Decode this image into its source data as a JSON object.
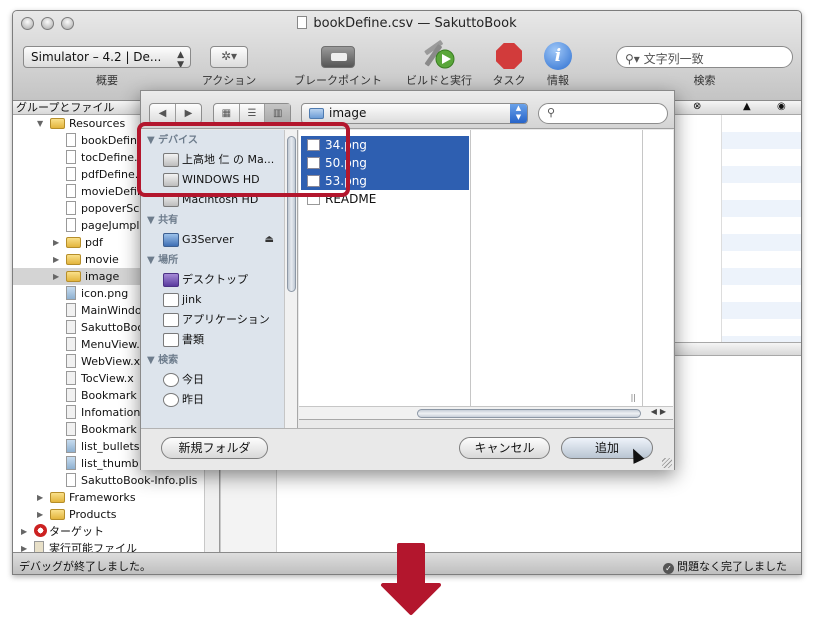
{
  "window": {
    "title": "bookDefine.csv — SakuttoBook",
    "toolbar": {
      "scheme": "Simulator – 4.2 | De...",
      "scheme_label": "概要",
      "action_label": "アクション",
      "breakpoint_label": "ブレークポイント",
      "build_label": "ビルドと実行",
      "task_label": "タスク",
      "info_label": "情報",
      "search_placeholder": "文字列一致",
      "search_label": "検索"
    },
    "sidebar": {
      "header": "グループとファイル",
      "items": [
        {
          "label": "Resources",
          "kind": "folder",
          "indent": 1,
          "open": true
        },
        {
          "label": "bookDefine",
          "kind": "file",
          "indent": 2
        },
        {
          "label": "tocDefine.",
          "kind": "file",
          "indent": 2
        },
        {
          "label": "pdfDefine.",
          "kind": "file",
          "indent": 2
        },
        {
          "label": "movieDefin",
          "kind": "file",
          "indent": 2
        },
        {
          "label": "popoverSc",
          "kind": "file",
          "indent": 2
        },
        {
          "label": "pageJumpl",
          "kind": "file",
          "indent": 2
        },
        {
          "label": "pdf",
          "kind": "folder",
          "indent": 2
        },
        {
          "label": "movie",
          "kind": "folder",
          "indent": 2
        },
        {
          "label": "image",
          "kind": "folder",
          "indent": 2,
          "selected": true
        },
        {
          "label": "icon.png",
          "kind": "img",
          "indent": 2
        },
        {
          "label": "MainWindo",
          "kind": "xib",
          "indent": 2
        },
        {
          "label": "SakuttoBoo",
          "kind": "xib",
          "indent": 2
        },
        {
          "label": "MenuView.",
          "kind": "xib",
          "indent": 2
        },
        {
          "label": "WebView.x",
          "kind": "xib",
          "indent": 2
        },
        {
          "label": "TocView.x",
          "kind": "xib",
          "indent": 2
        },
        {
          "label": "Bookmark",
          "kind": "xib",
          "indent": 2
        },
        {
          "label": "Infomation",
          "kind": "xib",
          "indent": 2
        },
        {
          "label": "Bookmark",
          "kind": "xib",
          "indent": 2
        },
        {
          "label": "list_bullets",
          "kind": "img",
          "indent": 2
        },
        {
          "label": "list_thumb",
          "kind": "img",
          "indent": 2
        },
        {
          "label": "SakuttoBook-Info.plis",
          "kind": "file",
          "indent": 2
        },
        {
          "label": "Frameworks",
          "kind": "folder",
          "indent": 1
        },
        {
          "label": "Products",
          "kind": "folder",
          "indent": 1
        },
        {
          "label": "ターゲット",
          "kind": "target",
          "indent": 0
        },
        {
          "label": "実行可能ファイル",
          "kind": "exec",
          "indent": 0
        }
      ]
    },
    "status": {
      "left": "デバッグが終了しました。",
      "right": "問題なく完了しました"
    }
  },
  "dialog": {
    "path": "image",
    "sources": {
      "devices_header": "デバイス",
      "devices": [
        "上高地 仁 の Ma...",
        "WINDOWS HD",
        "Macintosh HD"
      ],
      "shared_header": "共有",
      "shared": [
        "G3Server"
      ],
      "places_header": "場所",
      "places": [
        "デスクトップ",
        "jink",
        "アプリケーション",
        "書類"
      ],
      "search_header": "検索",
      "search": [
        "今日",
        "昨日"
      ]
    },
    "files": [
      {
        "name": "34.png",
        "selected": true
      },
      {
        "name": "50.png",
        "selected": true
      },
      {
        "name": "53.png",
        "selected": true
      },
      {
        "name": "README",
        "selected": false
      }
    ],
    "buttons": {
      "new_folder": "新規フォルダ",
      "cancel": "キャンセル",
      "add": "追加"
    }
  },
  "colors": {
    "selection": "#2e5fb1",
    "highlight_frame": "#b3162d",
    "arrow": "#b3162d"
  }
}
